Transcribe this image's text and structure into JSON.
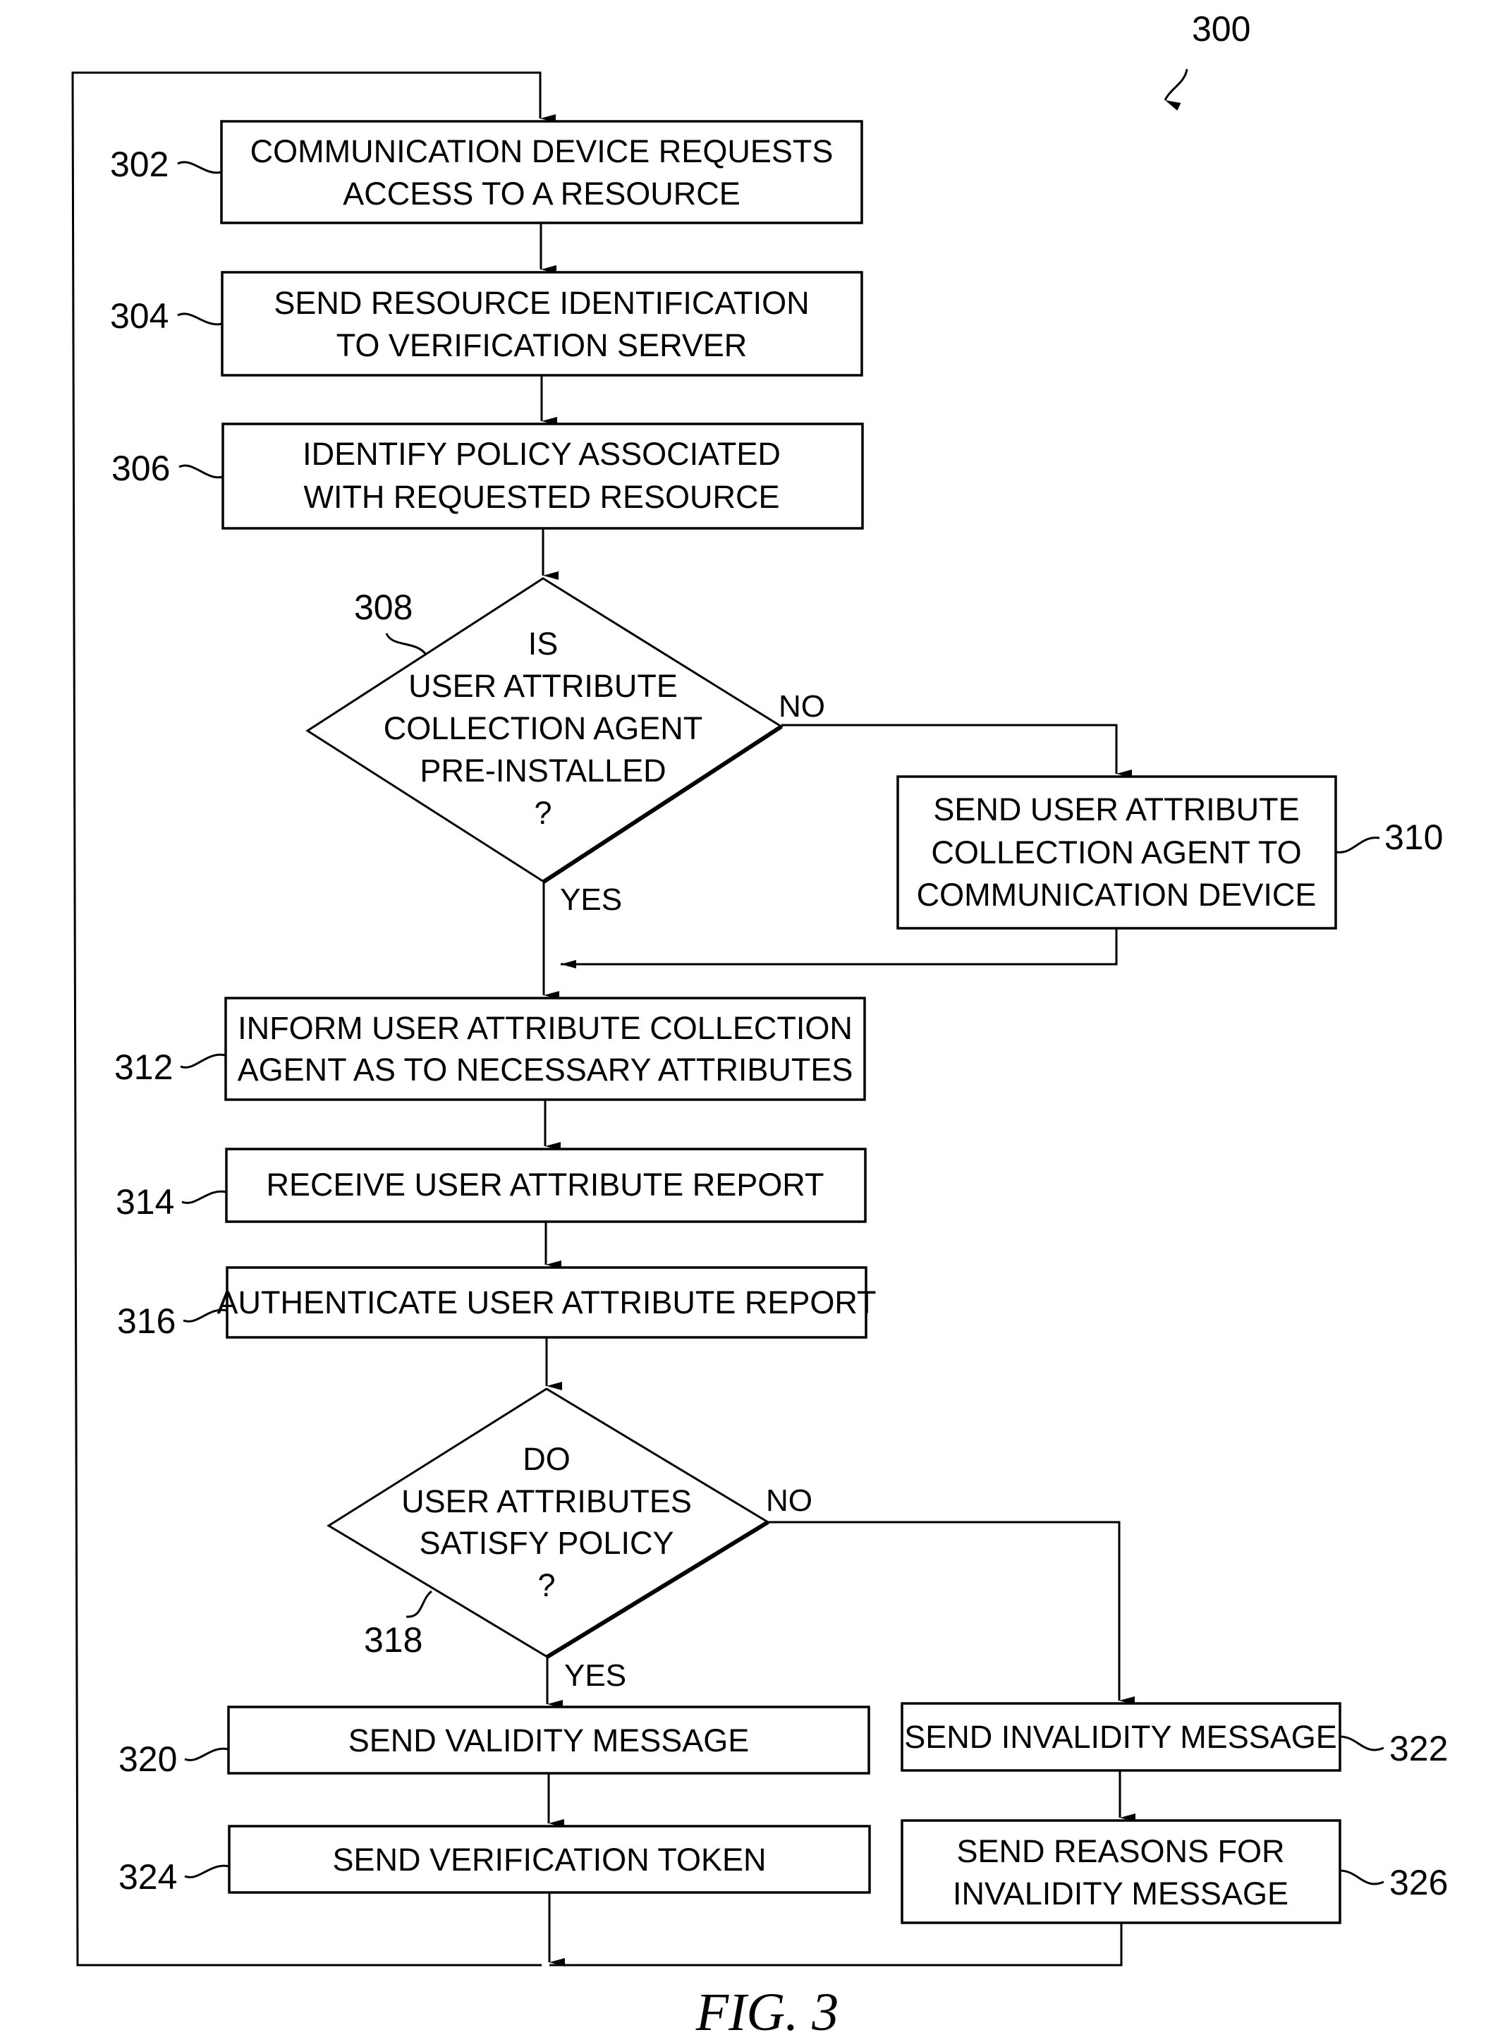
{
  "figure": {
    "reference_number": "300",
    "caption": "FIG. 3"
  },
  "steps": {
    "s302": {
      "ref": "302",
      "lines": [
        "COMMUNICATION DEVICE REQUESTS",
        "ACCESS TO A RESOURCE"
      ]
    },
    "s304": {
      "ref": "304",
      "lines": [
        "SEND RESOURCE IDENTIFICATION",
        "TO VERIFICATION SERVER"
      ]
    },
    "s306": {
      "ref": "306",
      "lines": [
        "IDENTIFY POLICY ASSOCIATED",
        "WITH REQUESTED RESOURCE"
      ]
    },
    "s308": {
      "ref": "308",
      "lines": [
        "IS",
        "USER ATTRIBUTE",
        "COLLECTION AGENT",
        "PRE-INSTALLED",
        "?"
      ],
      "yes": "YES",
      "no": "NO"
    },
    "s310": {
      "ref": "310",
      "lines": [
        "SEND USER ATTRIBUTE",
        "COLLECTION AGENT TO",
        "COMMUNICATION DEVICE"
      ]
    },
    "s312": {
      "ref": "312",
      "lines": [
        "INFORM USER ATTRIBUTE COLLECTION",
        "AGENT AS TO NECESSARY ATTRIBUTES"
      ]
    },
    "s314": {
      "ref": "314",
      "lines": [
        "RECEIVE USER ATTRIBUTE REPORT"
      ]
    },
    "s316": {
      "ref": "316",
      "lines": [
        "AUTHENTICATE USER ATTRIBUTE REPORT"
      ]
    },
    "s318": {
      "ref": "318",
      "lines": [
        "DO",
        "USER ATTRIBUTES",
        "SATISFY POLICY",
        "?"
      ],
      "yes": "YES",
      "no": "NO"
    },
    "s320": {
      "ref": "320",
      "lines": [
        "SEND VALIDITY MESSAGE"
      ]
    },
    "s322": {
      "ref": "322",
      "lines": [
        "SEND INVALIDITY MESSAGE"
      ]
    },
    "s324": {
      "ref": "324",
      "lines": [
        "SEND VERIFICATION TOKEN"
      ]
    },
    "s326": {
      "ref": "326",
      "lines": [
        "SEND REASONS FOR",
        "INVALIDITY MESSAGE"
      ]
    }
  }
}
